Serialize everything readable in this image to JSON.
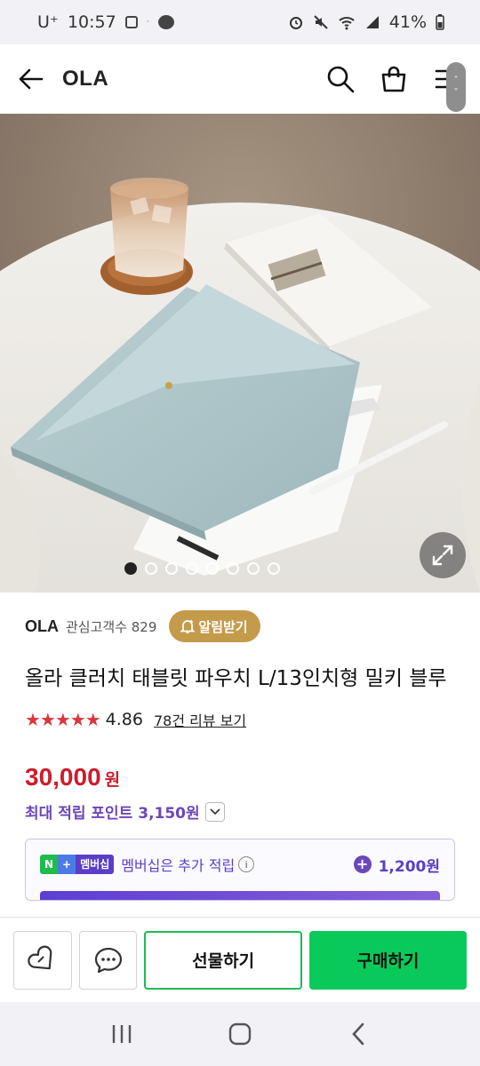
{
  "status_bar": {
    "carrier": "U⁺",
    "time": "10:57",
    "battery": "41%"
  },
  "header": {
    "brand": "OLA",
    "scroll_up": "˄",
    "scroll_down": "˅"
  },
  "hero": {
    "slide_count": 8,
    "active_slide": 1
  },
  "seller": {
    "name": "OLA",
    "followers_label": "관심고객수 829",
    "notify_label": "알림받기"
  },
  "product": {
    "title": "올라 클러치 태블릿 파우치 L/13인치형 밀키 블루",
    "stars": "★★★★★",
    "rating": "4.86",
    "review_link": "78건 리뷰 보기",
    "price": "30,000",
    "currency": "원",
    "max_points": "최대 적립 포인트 3,150원"
  },
  "membership": {
    "badge_n": "N",
    "badge_plus": "+",
    "badge_label": "멤버십",
    "text": "멤버십은 추가 적립",
    "info": "i",
    "plus_sign": "+",
    "points": "1,200원"
  },
  "actions": {
    "gift_label": "선물하기",
    "buy_label": "구매하기"
  },
  "colors": {
    "price": "#cc1d2c",
    "points": "#6b47b8",
    "buy_button": "#09c95a",
    "notify_button": "#c49a4b"
  }
}
